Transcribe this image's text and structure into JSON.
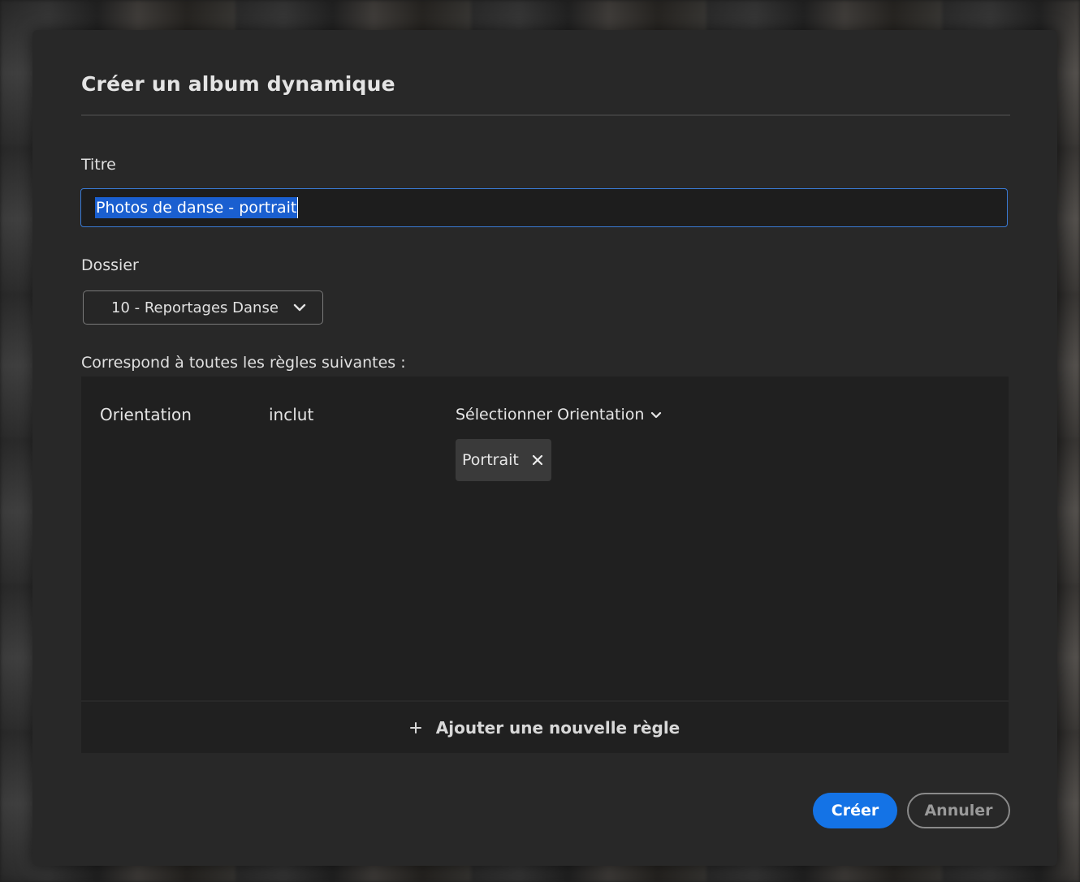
{
  "dialog": {
    "title": "Créer un album dynamique"
  },
  "title_field": {
    "label": "Titre",
    "value": "Photos de danse - portrait"
  },
  "folder_field": {
    "label": "Dossier",
    "selected": "10 - Reportages Danse"
  },
  "rules": {
    "header": "Correspond à toutes les règles suivantes :",
    "items": [
      {
        "attribute": "Orientation",
        "operator": "inclut",
        "value_select": "Sélectionner Orientation",
        "tags": [
          "Portrait"
        ]
      }
    ],
    "add_rule_label": "Ajouter une nouvelle règle"
  },
  "buttons": {
    "create": "Créer",
    "cancel": "Annuler"
  },
  "colors": {
    "accent": "#1473e6",
    "selection": "#1a5fd0",
    "dialog_bg": "#282828"
  },
  "icons": {
    "folder_dropdown": "chevron-down-icon",
    "orientation_dropdown": "chevron-down-icon",
    "tag_remove": "close-icon",
    "add_rule": "plus-icon"
  }
}
